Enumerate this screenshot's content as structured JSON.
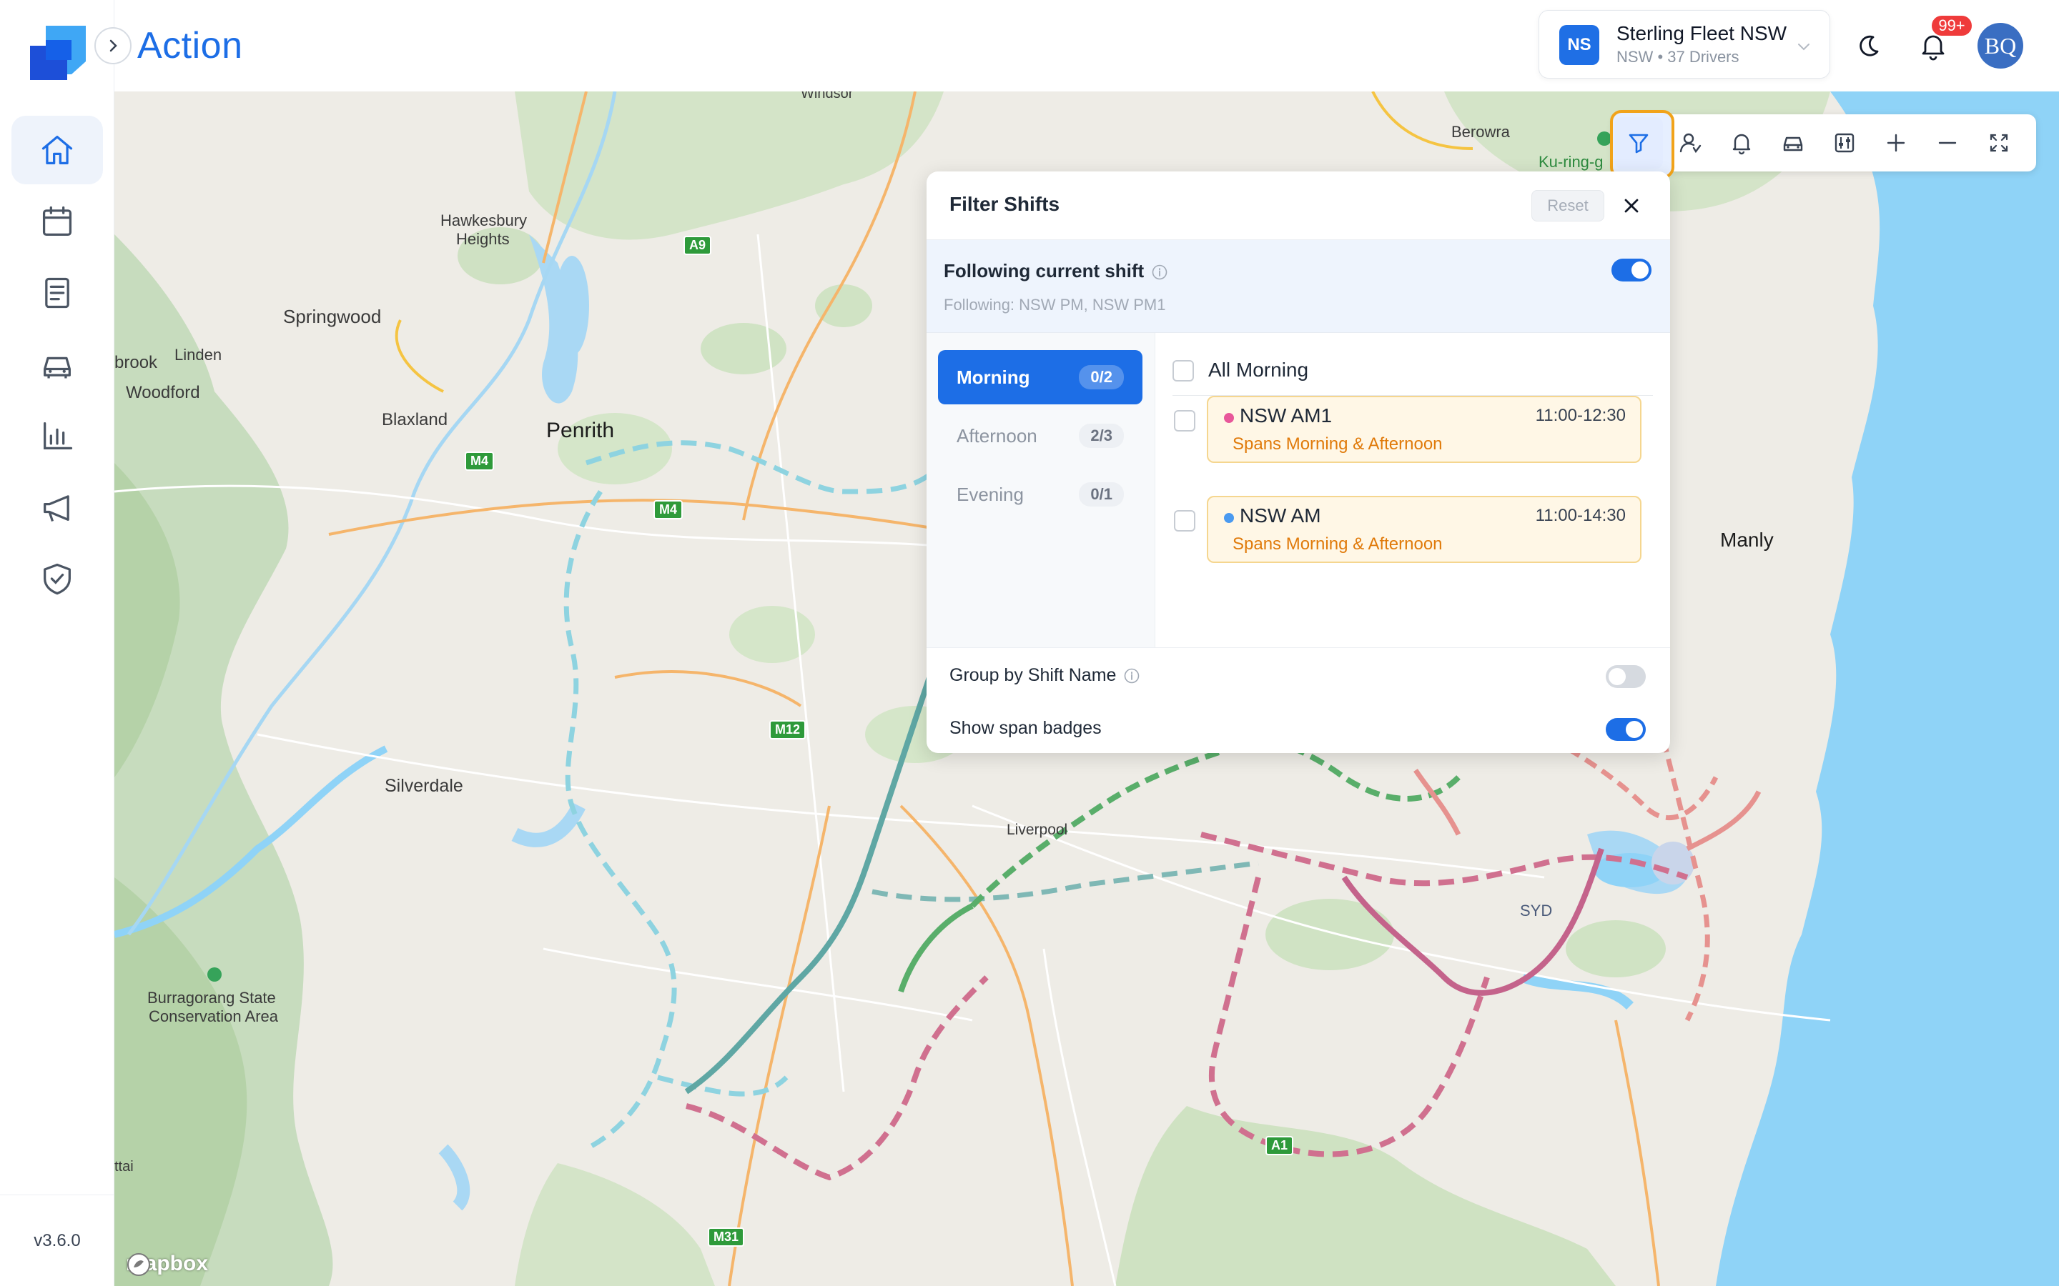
{
  "app": {
    "title": "Action",
    "version": "v3.6.0"
  },
  "sidebar": {
    "items": [
      {
        "name": "home",
        "icon": "home-icon",
        "active": true
      },
      {
        "name": "calendar",
        "icon": "calendar-icon",
        "active": false
      },
      {
        "name": "documents",
        "icon": "document-icon",
        "active": false
      },
      {
        "name": "vehicles",
        "icon": "car-icon",
        "active": false
      },
      {
        "name": "reports",
        "icon": "bar-chart-icon",
        "active": false
      },
      {
        "name": "announcements",
        "icon": "megaphone-icon",
        "active": false
      },
      {
        "name": "compliance",
        "icon": "shield-check-icon",
        "active": false
      }
    ]
  },
  "header": {
    "org": {
      "badge": "NS",
      "name": "Sterling Fleet NSW",
      "sub": "NSW • 37 Drivers"
    },
    "notifications": "99+",
    "avatar": "BQ"
  },
  "map_toolbar": {
    "buttons": [
      "filter-icon",
      "driver-icon",
      "bell-icon",
      "car-icon",
      "sliders-icon",
      "plus-icon",
      "minus-icon",
      "fullscreen-icon"
    ]
  },
  "filter": {
    "title": "Filter Shifts",
    "reset_label": "Reset",
    "following": {
      "title": "Following current shift",
      "sub": "Following: NSW PM, NSW PM1",
      "enabled": true
    },
    "tabs": [
      {
        "label": "Morning",
        "count": "0/2",
        "active": true
      },
      {
        "label": "Afternoon",
        "count": "2/3",
        "active": false
      },
      {
        "label": "Evening",
        "count": "0/1",
        "active": false
      }
    ],
    "all_label": "All Morning",
    "shifts": [
      {
        "name": "NSW AM1",
        "time": "11:00-12:30",
        "span": "Spans Morning & Afternoon",
        "dot_color": "#e8579a"
      },
      {
        "name": "NSW AM",
        "time": "11:00-14:30",
        "span": "Spans Morning & Afternoon",
        "dot_color": "#4a9af0"
      }
    ],
    "group_by_label": "Group by Shift Name",
    "group_by_enabled": false,
    "span_badges_label": "Show span badges",
    "span_badges_enabled": true
  },
  "map": {
    "labels": {
      "windsor": "Windsor",
      "berowra": "Berowra",
      "kuringgai": "Ku-ring-g",
      "hawkesbury1": "Hawkesbury",
      "hawkesbury2": "Heights",
      "springwood": "Springwood",
      "linden": "Linden",
      "brook": "brook",
      "woodford": "Woodford",
      "blaxland": "Blaxland",
      "penrith": "Penrith",
      "manly": "Manly",
      "silverdale": "Silverdale",
      "liverpool": "Liverpool",
      "syd": "SYD",
      "burragorang1": "Burragorang State",
      "burragorang2": "Conservation Area",
      "ttai": "ttai"
    },
    "shields": {
      "a9": "A9",
      "m4a": "M4",
      "m4b": "M4",
      "m12": "M12",
      "a1": "A1",
      "m31": "M31"
    },
    "attribution": "mapbox"
  }
}
